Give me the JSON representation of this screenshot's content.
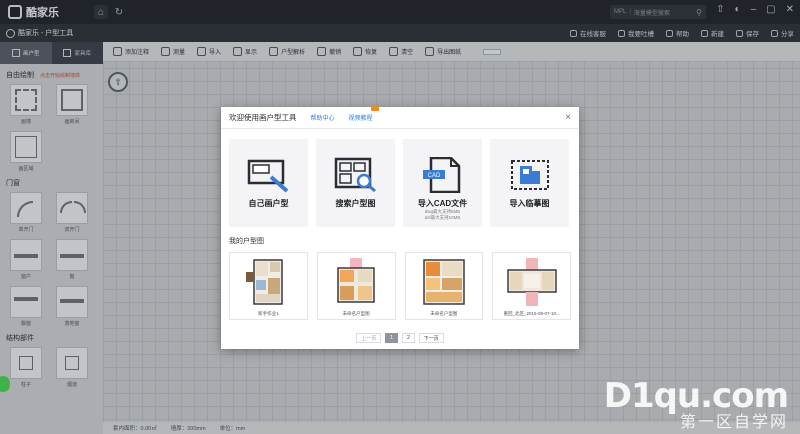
{
  "titlebar": {
    "logo_text": "酷家乐",
    "search_left": "MPL",
    "search_placeholder": "海量模型搜索"
  },
  "appbar": {
    "app_name": "酷家乐 - 户型工具",
    "right_tools": [
      "在线客服",
      "我要吐槽",
      "帮助",
      "新建",
      "保存",
      "分享"
    ]
  },
  "sidebar": {
    "tabs": [
      "画户型",
      "家具库"
    ],
    "sections": [
      {
        "title": "自由绘制",
        "warn": "点击开始绘制墙体",
        "items": [
          "画墙",
          "画房间",
          "画区域"
        ]
      },
      {
        "title": "门窗",
        "items": [
          "单开门",
          "双开门",
          "窗户",
          "窗",
          "飘窗",
          "落地窗"
        ]
      },
      {
        "title": "结构部件",
        "items": [
          "柱子",
          "烟道"
        ]
      }
    ]
  },
  "canvas_toolbar": {
    "items": [
      "添加注释",
      "测量",
      "导入",
      "显示",
      "户型解析",
      "撤销",
      "恢复",
      "清空"
    ],
    "button": "导出图纸",
    "end_button": ""
  },
  "statusbar": {
    "items": [
      "套内面积：0.00㎡",
      "墙厚：200mm",
      "单位：mm"
    ]
  },
  "dialog": {
    "title": "欢迎使用画户型工具",
    "links": [
      "帮助中心",
      "视频教程"
    ],
    "close": "×",
    "cards": [
      {
        "label": "自己画户型",
        "icon": "draw-plan-icon",
        "sub": []
      },
      {
        "label": "搜索户型图",
        "icon": "search-plan-icon",
        "sub": []
      },
      {
        "label": "导入CAD文件",
        "icon": "cad-file-icon",
        "sub": [
          "dwg最大支持5MB",
          "dxf最大支持10MB"
        ]
      },
      {
        "label": "导入临摹图",
        "icon": "trace-image-icon",
        "sub": []
      }
    ],
    "section_title": "我的户型图",
    "plans": [
      {
        "caption": "新手作业1"
      },
      {
        "caption": "未命名户型图"
      },
      {
        "caption": "未命名户型图"
      },
      {
        "caption": "重回_北区_2015-09-07-10..."
      }
    ],
    "pager": {
      "prev": "上一页",
      "pages": [
        "1",
        "2"
      ],
      "next": "下一页"
    }
  },
  "watermark": {
    "main": "D1qu.com",
    "sub": "第一区自学网"
  },
  "colors": {
    "accent": "#2f7ee0",
    "titlebar": "#1f2329",
    "card_bg": "#f4f4f7",
    "icon_blue": "#3a7bd5"
  }
}
